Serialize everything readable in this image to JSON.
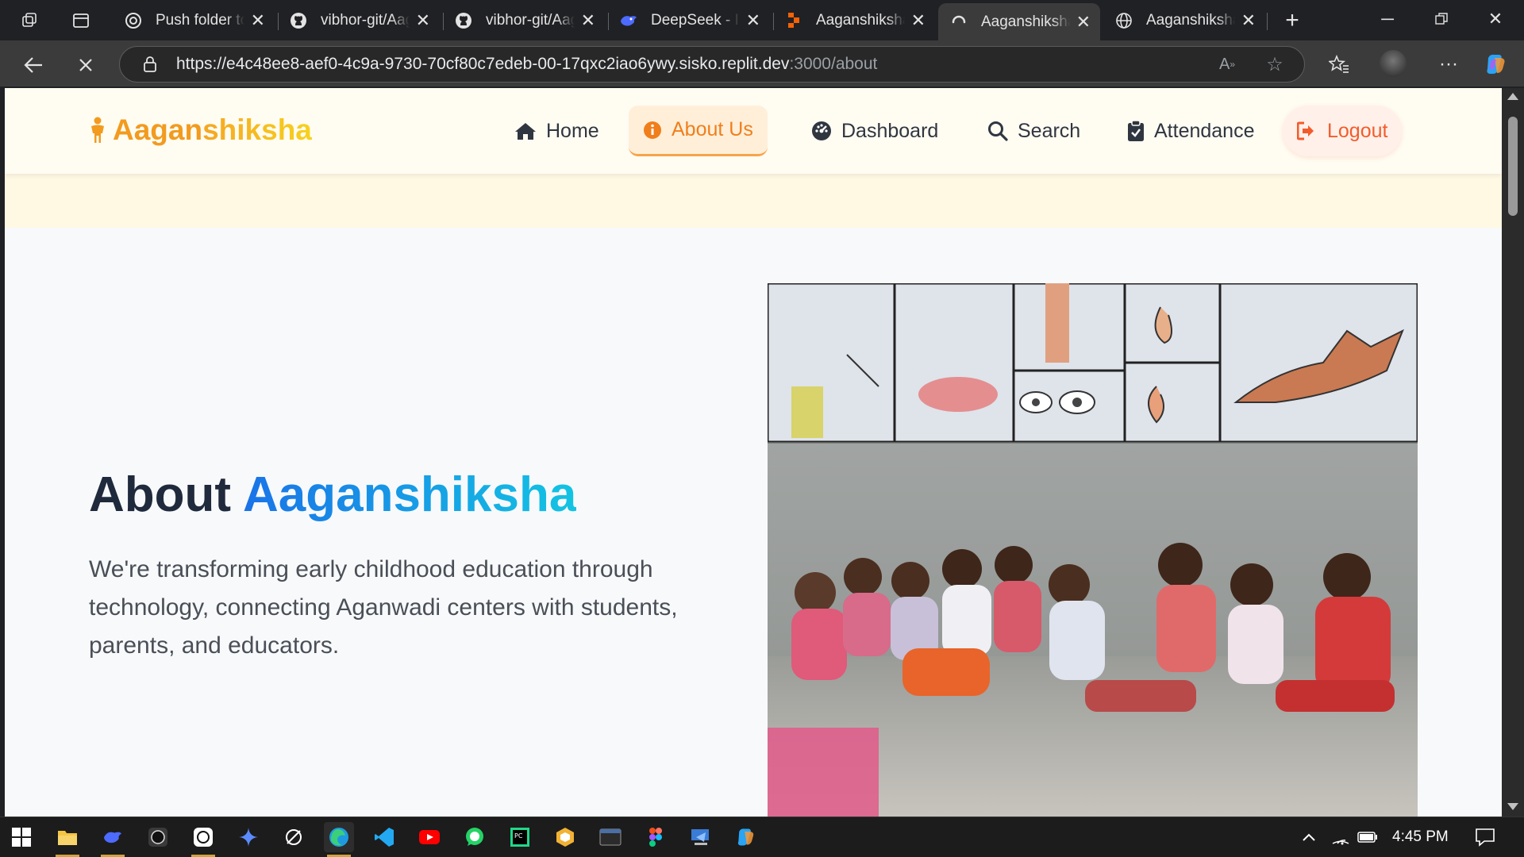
{
  "browser": {
    "tabs": [
      {
        "title": "Push folder to",
        "icon": "chatgpt-icon"
      },
      {
        "title": "vibhor-git/Aag",
        "icon": "github-icon"
      },
      {
        "title": "vibhor-git/Aag",
        "icon": "github-icon"
      },
      {
        "title": "DeepSeek - Int",
        "icon": "deepseek-icon"
      },
      {
        "title": "Aaganshiksha",
        "icon": "replit-icon"
      },
      {
        "title": "Aaganshiksha",
        "icon": "loading-icon",
        "active": true
      },
      {
        "title": "Aaganshiksha",
        "icon": "globe-icon"
      }
    ],
    "url_main": "https://e4c48ee8-aef0-4c9a-9730-70cf80c7edeb-00-17qxc2iao6ywy.sisko.replit.dev",
    "url_rest": ":3000/about"
  },
  "site": {
    "logo_part1": "Aagan",
    "logo_part2": "shiksha",
    "nav": [
      {
        "label": "Home",
        "icon": "home-icon"
      },
      {
        "label": "About Us",
        "icon": "info-icon",
        "active": true
      },
      {
        "label": "Dashboard",
        "icon": "dashboard-icon"
      },
      {
        "label": "Search",
        "icon": "search-icon"
      },
      {
        "label": "Attendance",
        "icon": "clipboard-check-icon"
      },
      {
        "label": "Logout",
        "icon": "sign-out-icon"
      }
    ],
    "heading_plain": "About ",
    "heading_accent1": "Aagan",
    "heading_accent2": "shiksha",
    "description": "We're transforming early childhood education through technology, connecting Aganwadi centers with students, parents, and educators."
  },
  "colors": {
    "brand_orange": "#f29b1f",
    "brand_blue": "#1a73e8",
    "nav_active_bg": "#ffefd9",
    "logout": "#f25c2b"
  },
  "taskbar": {
    "time": "4:45 PM",
    "apps": [
      "windows-start-icon",
      "file-explorer-icon",
      "deepseek-icon",
      "obs-icon",
      "chatgpt-icon",
      "gemini-icon",
      "perplexity-icon",
      "edge-icon",
      "vscode-icon",
      "youtube-icon",
      "whatsapp-icon",
      "pycharm-icon",
      "app-icon",
      "terminal-icon",
      "figma-icon",
      "remote-desktop-icon",
      "copilot-icon"
    ]
  }
}
